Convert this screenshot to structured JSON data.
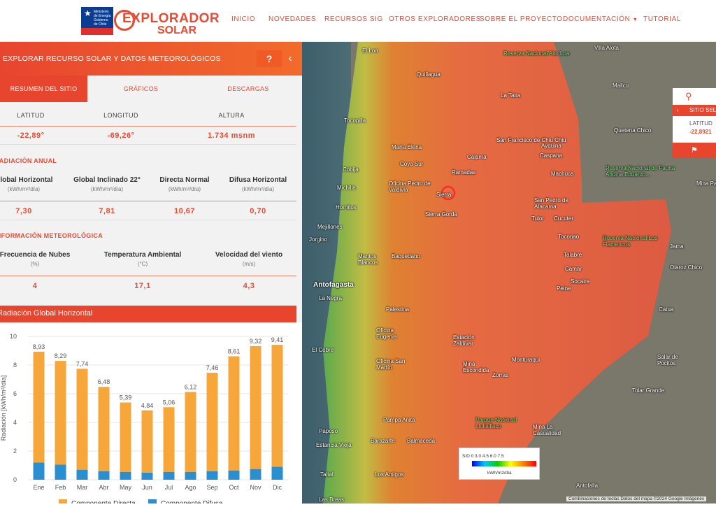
{
  "header": {
    "gov_text": "Ministerio de Energía Gobierno de Chile",
    "brand_line1": "EXPLORADOR",
    "brand_line2": "SOLAR",
    "nav": [
      "INICIO",
      "NOVEDADES",
      "RECURSOS SIG",
      "OTROS EXPLORADORES",
      "SOBRE EL PROYECTO",
      "DOCUMENTACIÓN",
      "TUTORIAL"
    ]
  },
  "panel": {
    "title": "EXPLORAR RECURSO SOLAR Y DATOS METEOROLÓGICOS",
    "help": "?",
    "collapse": "‹",
    "tabs": [
      "RESUMEN DEL SITIO",
      "GRÁFICOS",
      "DESCARGAS"
    ],
    "coords": {
      "headers": [
        "LATITUD",
        "LONGITUD",
        "ALTURA"
      ],
      "values": [
        "-22,89°",
        "-69,26°",
        "1.734 msnm"
      ]
    },
    "radiacion": {
      "section": "RADIACIÓN ANUAL",
      "captions": [
        "Global Horizontal",
        "Global Inclinado 22°",
        "Directa Normal",
        "Difusa Horizontal"
      ],
      "units": [
        "(kWh/m²/día)",
        "(kWh/m²/día)",
        "(kWh/m²/día)",
        "(kWh/m²/día)"
      ],
      "values": [
        "7,30",
        "7,81",
        "10,67",
        "0,70"
      ]
    },
    "meteo": {
      "section": "INFORMACIÓN METEOROLÓGICA",
      "captions": [
        "Frecuencia de Nubes",
        "Temperatura Ambiental",
        "Velocidad del viento"
      ],
      "units": [
        "(%)",
        "(°C)",
        "(m/s)"
      ],
      "values": [
        "4",
        "17,1",
        "4,3"
      ]
    },
    "chart_title": "Radiación Global Horizontal"
  },
  "chart_data": {
    "type": "bar",
    "stacked": true,
    "categories": [
      "Ene",
      "Feb",
      "Mar",
      "Abr",
      "May",
      "Jun",
      "Jul",
      "Ago",
      "Sep",
      "Oct",
      "Nov",
      "Dic"
    ],
    "totals": [
      "8,93",
      "8,29",
      "7,74",
      "6,48",
      "5,39",
      "4,84",
      "5,06",
      "6,12",
      "7,46",
      "8,61",
      "9,32",
      "9,41"
    ],
    "series": [
      {
        "name": "Componente Difusa",
        "color": "#2a8fd0",
        "values": [
          1.2,
          1.05,
          0.7,
          0.6,
          0.55,
          0.5,
          0.55,
          0.55,
          0.6,
          0.65,
          0.75,
          0.9
        ]
      },
      {
        "name": "Componente Directa",
        "color": "#f7a73a",
        "values": [
          7.73,
          7.24,
          7.04,
          5.88,
          4.84,
          4.34,
          4.51,
          5.57,
          6.86,
          7.96,
          8.57,
          8.51
        ]
      }
    ],
    "ylabel": "Radiación [kWh/m²/día]",
    "yticks": [
      "0",
      "2",
      "4",
      "6",
      "8",
      "10"
    ],
    "ylim": [
      0,
      10
    ],
    "legend_position": "bottom"
  },
  "map": {
    "labels": [
      {
        "text": "Villa Alota",
        "cls": ""
      },
      {
        "text": "Reserva Nacional Alto Loa",
        "cls": "green"
      },
      {
        "text": "El Loa",
        "cls": ""
      },
      {
        "text": "Quillagua",
        "cls": ""
      },
      {
        "text": "La Taira",
        "cls": ""
      },
      {
        "text": "Mallcu",
        "cls": ""
      },
      {
        "text": "Tocopilla",
        "cls": ""
      },
      {
        "text": "María Elena",
        "cls": ""
      },
      {
        "text": "San Francisco de Chiu Chiu",
        "cls": ""
      },
      {
        "text": "Ayquina",
        "cls": ""
      },
      {
        "text": "Quetena Chico",
        "cls": ""
      },
      {
        "text": "Coya Sur",
        "cls": ""
      },
      {
        "text": "Calama",
        "cls": ""
      },
      {
        "text": "Caspana",
        "cls": ""
      },
      {
        "text": "Cobija",
        "cls": ""
      },
      {
        "text": "Ramadas",
        "cls": ""
      },
      {
        "text": "Machuca",
        "cls": ""
      },
      {
        "text": "Reserva Nacional de Fauna Andina Eduardo...",
        "cls": "green"
      },
      {
        "text": "Michilla",
        "cls": ""
      },
      {
        "text": "Oficina Pedro de Valdivia",
        "cls": ""
      },
      {
        "text": "Sierra",
        "cls": ""
      },
      {
        "text": "Mina Pal",
        "cls": ""
      },
      {
        "text": "Hornitos",
        "cls": ""
      },
      {
        "text": "San Pedro de Atacama",
        "cls": ""
      },
      {
        "text": "Sierra Gorda",
        "cls": ""
      },
      {
        "text": "Tulor",
        "cls": ""
      },
      {
        "text": "Cucuter",
        "cls": ""
      },
      {
        "text": "Mejillones",
        "cls": ""
      },
      {
        "text": "Toconao",
        "cls": ""
      },
      {
        "text": "Jorgino",
        "cls": ""
      },
      {
        "text": "Reserva Nacional Los Flamencos",
        "cls": "green"
      },
      {
        "text": "Jama",
        "cls": ""
      },
      {
        "text": "Mantos Blancos",
        "cls": ""
      },
      {
        "text": "Baquedano",
        "cls": ""
      },
      {
        "text": "Talabre",
        "cls": ""
      },
      {
        "text": "Olaroz Chico",
        "cls": ""
      },
      {
        "text": "Camar",
        "cls": ""
      },
      {
        "text": "Antofagasta",
        "cls": ""
      },
      {
        "text": "Socaire",
        "cls": ""
      },
      {
        "text": "La Negra",
        "cls": ""
      },
      {
        "text": "Peine",
        "cls": ""
      },
      {
        "text": "Palestina",
        "cls": ""
      },
      {
        "text": "Catua",
        "cls": ""
      },
      {
        "text": "Oficina Eugenia",
        "cls": ""
      },
      {
        "text": "Estación Zaldívar",
        "cls": ""
      },
      {
        "text": "El Cobre",
        "cls": ""
      },
      {
        "text": "Monturaqui",
        "cls": ""
      },
      {
        "text": "Salar de Pocitos",
        "cls": ""
      },
      {
        "text": "Oficina San Martín",
        "cls": ""
      },
      {
        "text": "Mina Escondida",
        "cls": ""
      },
      {
        "text": "Zorras",
        "cls": ""
      },
      {
        "text": "Tolar Grande",
        "cls": ""
      },
      {
        "text": "Pampa Anita",
        "cls": ""
      },
      {
        "text": "Paposo",
        "cls": ""
      },
      {
        "text": "Parque Nacional Llullaillaco",
        "cls": "green"
      },
      {
        "text": "Mina La Casualidad",
        "cls": ""
      },
      {
        "text": "Estancia Vieja",
        "cls": ""
      },
      {
        "text": "Barazarte",
        "cls": ""
      },
      {
        "text": "Balmaceda",
        "cls": ""
      },
      {
        "text": "Los Amigos",
        "cls": ""
      },
      {
        "text": "Taltal",
        "cls": ""
      },
      {
        "text": "Las Breas",
        "cls": ""
      },
      {
        "text": "Antofalla",
        "cls": ""
      }
    ],
    "legend_nums": "S/D  0   3.0   4.5   6.0   7.5",
    "legend_units": "kWh/m2/día",
    "site_box": {
      "label": "SITIO SELECCIONADO",
      "lat_label": "LATITUD",
      "lat_value": "-22,8921"
    },
    "attribution": "Combinaciones de teclas   Datos del mapa ©2024 Google Imágenes"
  }
}
